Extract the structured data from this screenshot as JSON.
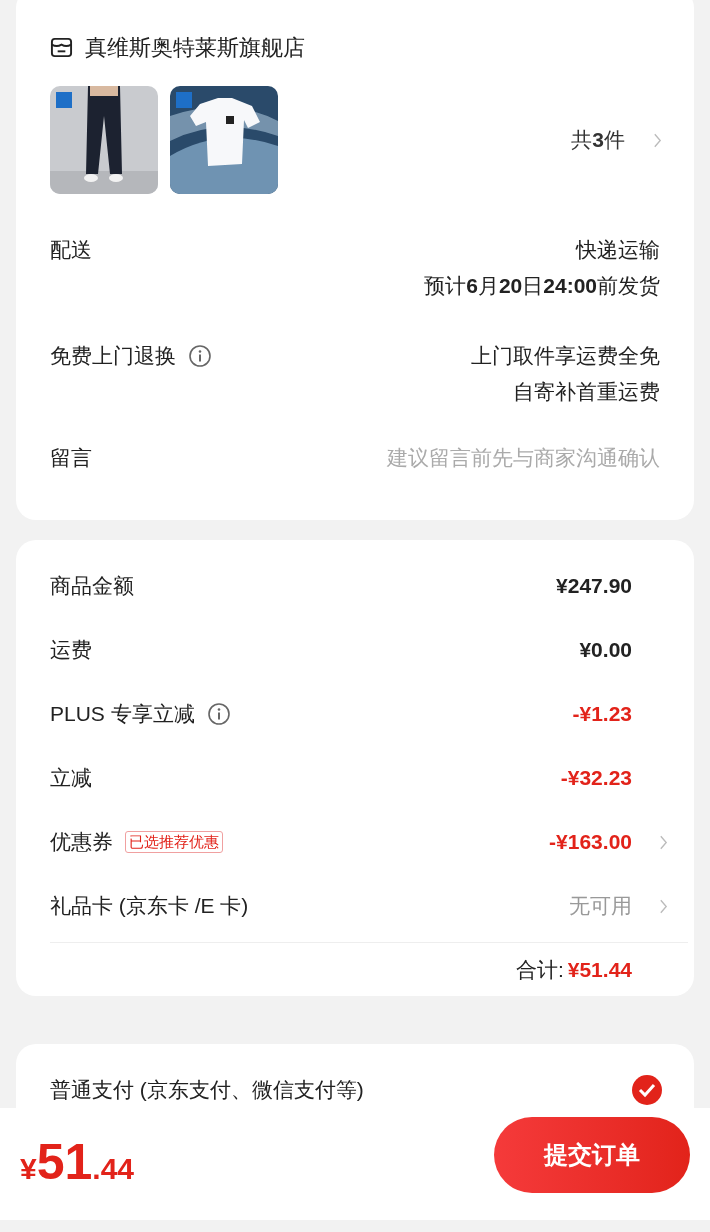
{
  "store": {
    "name": "真维斯奥特莱斯旗舰店"
  },
  "item_count": "共**3**件",
  "order_rows": [
    {
      "label": "配送",
      "info": false,
      "values": [
        "快递运输",
        "预计**6**月**20**日**24:00**前发货"
      ]
    },
    {
      "label": "免费上门退换",
      "info": true,
      "values": [
        "上门取件享运费全免",
        "自寄补首重运费"
      ]
    },
    {
      "label": "留言",
      "info": false,
      "placeholder": "建议留言前先与商家沟通确认"
    }
  ],
  "price_rows": [
    {
      "label": "商品金额",
      "info": false,
      "amount": "¥247.90",
      "color": "#222222",
      "muted": false,
      "chevron": false
    },
    {
      "label": "运费",
      "info": false,
      "amount": "¥0.00",
      "color": "#222222",
      "muted": false,
      "chevron": false
    },
    {
      "label": "PLUS 专享立减",
      "info": true,
      "amount": "-¥1.23",
      "color": "#e2231a",
      "muted": false,
      "chevron": false
    },
    {
      "label": "立减",
      "info": false,
      "amount": "-¥32.23",
      "color": "#e2231a",
      "muted": false,
      "chevron": false
    },
    {
      "label": "优惠券",
      "info": false,
      "tag": "已选推荐优惠",
      "amount": "-¥163.00",
      "color": "#e2231a",
      "muted": false,
      "chevron": true
    },
    {
      "label": "礼品卡 (京东卡 /E 卡)",
      "info": false,
      "amount": "无可用",
      "color": "#999999",
      "muted": true,
      "chevron": true
    }
  ],
  "total": {
    "label": "合计:",
    "amount": "¥51.44"
  },
  "payment": {
    "label": "普通支付 (京东支付、微信支付等)",
    "selected": true
  },
  "bottom_bar": {
    "currency": "¥",
    "integer": "51",
    "decimal": ".44",
    "submit": "提交订单"
  }
}
